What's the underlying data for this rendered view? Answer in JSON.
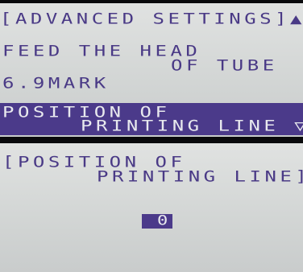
{
  "advanced_settings": {
    "title": "[ADVANCED SETTINGS]",
    "scroll_up_glyph": "▲",
    "item1_line1": "FEED THE HEAD",
    "item1_line2": "OF TUBE",
    "item1_value": "6.9MARK",
    "item2_line1": "POSITION OF",
    "item2_line2": "PRINTING LINE",
    "scroll_down_glyph": "▽"
  },
  "position_screen": {
    "title_line1": "[POSITION OF",
    "title_line2": "PRINTING LINE]",
    "value": "0"
  },
  "colors": {
    "lcd_background": "#d6d8d7",
    "pixel_text": "#4a3a86",
    "highlight": "#4b3a8a",
    "highlight_text": "#e8e9ee"
  }
}
